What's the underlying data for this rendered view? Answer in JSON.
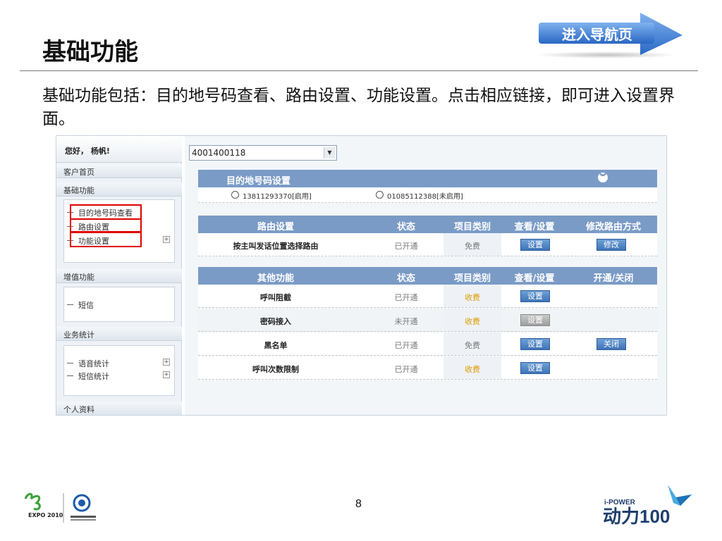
{
  "slide": {
    "title": "基础功能",
    "nav_button": "进入导航页",
    "intro": "基础功能包括：目的地号码查看、路由设置、功能设置。点击相应链接，即可进入设置界面。",
    "page_number": "8"
  },
  "sidebar": {
    "greeting": "您好， 杨帆!",
    "home": "客户首页",
    "basic_head": "基础功能",
    "basic_items": [
      "目的地号码查看",
      "路由设置",
      "功能设置"
    ],
    "value_head": "增值功能",
    "value_items": [
      "短信"
    ],
    "stats_head": "业务统计",
    "stats_items": [
      "语音统计",
      "短信统计"
    ],
    "profile_head": "个人资料"
  },
  "main": {
    "number_select": "4001400118",
    "dest_panel": {
      "title": "目的地号码设置",
      "options": [
        "13811293370[启用]",
        "01085112388[未启用]"
      ]
    },
    "route_panel": {
      "headers": [
        "路由设置",
        "状态",
        "项目类别",
        "查看/设置",
        "修改路由方式"
      ],
      "row": {
        "name": "按主叫发话位置选择路由",
        "status": "已开通",
        "category": "免费",
        "view_btn": "设置",
        "modify_btn": "修改"
      }
    },
    "other_panel": {
      "headers": [
        "其他功能",
        "状态",
        "项目类别",
        "查看/设置",
        "开通/关闭"
      ],
      "rows": [
        {
          "name": "呼叫阻截",
          "status": "已开通",
          "category": "收费",
          "view_btn": "设置",
          "toggle_btn": ""
        },
        {
          "name": "密码接入",
          "status": "未开通",
          "category": "收费",
          "view_btn": "设置",
          "toggle_btn": ""
        },
        {
          "name": "黑名单",
          "status": "已开通",
          "category": "免费",
          "view_btn": "设置",
          "toggle_btn": "关闭"
        },
        {
          "name": "呼叫次数限制",
          "status": "已开通",
          "category": "收费",
          "view_btn": "设置",
          "toggle_btn": ""
        }
      ]
    }
  },
  "logos": {
    "left_expo": "EXPO 2010",
    "right_brand": "i-POWER",
    "right_name": "动力100"
  },
  "colors": {
    "panel_header": "#7a9bc6",
    "button_blue": "#3e73b8",
    "paid_orange": "#e09a00",
    "highlight_red": "#e00000",
    "nav_arrow": "#3a7ad0"
  }
}
